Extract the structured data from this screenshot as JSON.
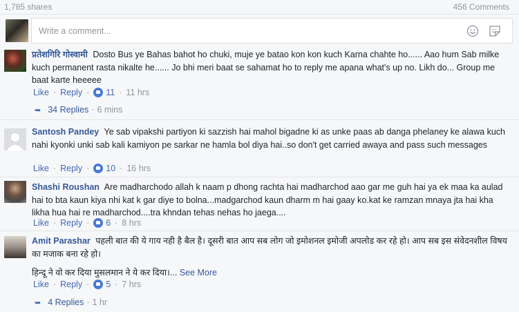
{
  "stats": {
    "shares": "1,785 shares",
    "comments": "456 Comments"
  },
  "composer": {
    "placeholder": "Write a comment...",
    "emoji_icon": "smiley-icon",
    "sticker_icon": "sticker-icon"
  },
  "comments": [
    {
      "author": "प्रतेशगिरि गोस्वामी",
      "text": "Dosto Bus ye Bahas bahot ho chuki, muje ye batao kon kon kuch Karna chahte ho...... Aao hum Sab milke kuch permanent rasta nikalte he...... Jo bhi meri baat se sahamat ho to reply me apana what's up no. Likh do... Group me baat karte heeeee",
      "like_label": "Like",
      "reply_label": "Reply",
      "likes": "11",
      "time": "11 hrs",
      "replies": "34 Replies",
      "replies_time": "6 mins"
    },
    {
      "author": "Santosh Pandey",
      "text": "Ye sab vipakshi partiyon ki sazzish hai mahol bigadne ki as unke paas ab danga phelaney ke alawa kuch nahi kyonki unki sab kali kamiyon pe sarkar ne hamla bol diya hai..so don't get carried awaya and pass such messages",
      "like_label": "Like",
      "reply_label": "Reply",
      "likes": "10",
      "time": "16 hrs"
    },
    {
      "author": "Shashi Roushan",
      "text": "Are madharchodo allah k naam p dhong rachta hai madharchod aao gar me guh hai ya ek maa ka aulad hai to bta kaun kiya nhi kat k gar diye to bolna...madgarchod kaun dharm m hai gaay ko.kat ke ramzan mnaya jta hai kha likha hua hai re madharchod....tra khndan tehas nehas ho jaega....",
      "like_label": "Like",
      "reply_label": "Reply",
      "likes": "6",
      "time": "8 hrs"
    },
    {
      "author": "Amit Parashar",
      "text": "पहली बात की ये गाय नही है बैल है। दूसरी बात आप सब लोग जो इमोशनल इमोजी अपलोड कर रहे हो। आप सब इस संवेदनशील विषय का मजाक बना रहे हो।",
      "text2": "हिन्दू ने वो कर दिया मुसलमान ने ये कर दिया।...",
      "see_more": "See More",
      "like_label": "Like",
      "reply_label": "Reply",
      "likes": "5",
      "time": "7 hrs",
      "replies": "4 Replies",
      "replies_time": "1 hr"
    }
  ],
  "colors": {
    "link": "#365899",
    "meta": "#90949c",
    "like_badge": "#4a79d0",
    "background": "#f6f7f9"
  }
}
